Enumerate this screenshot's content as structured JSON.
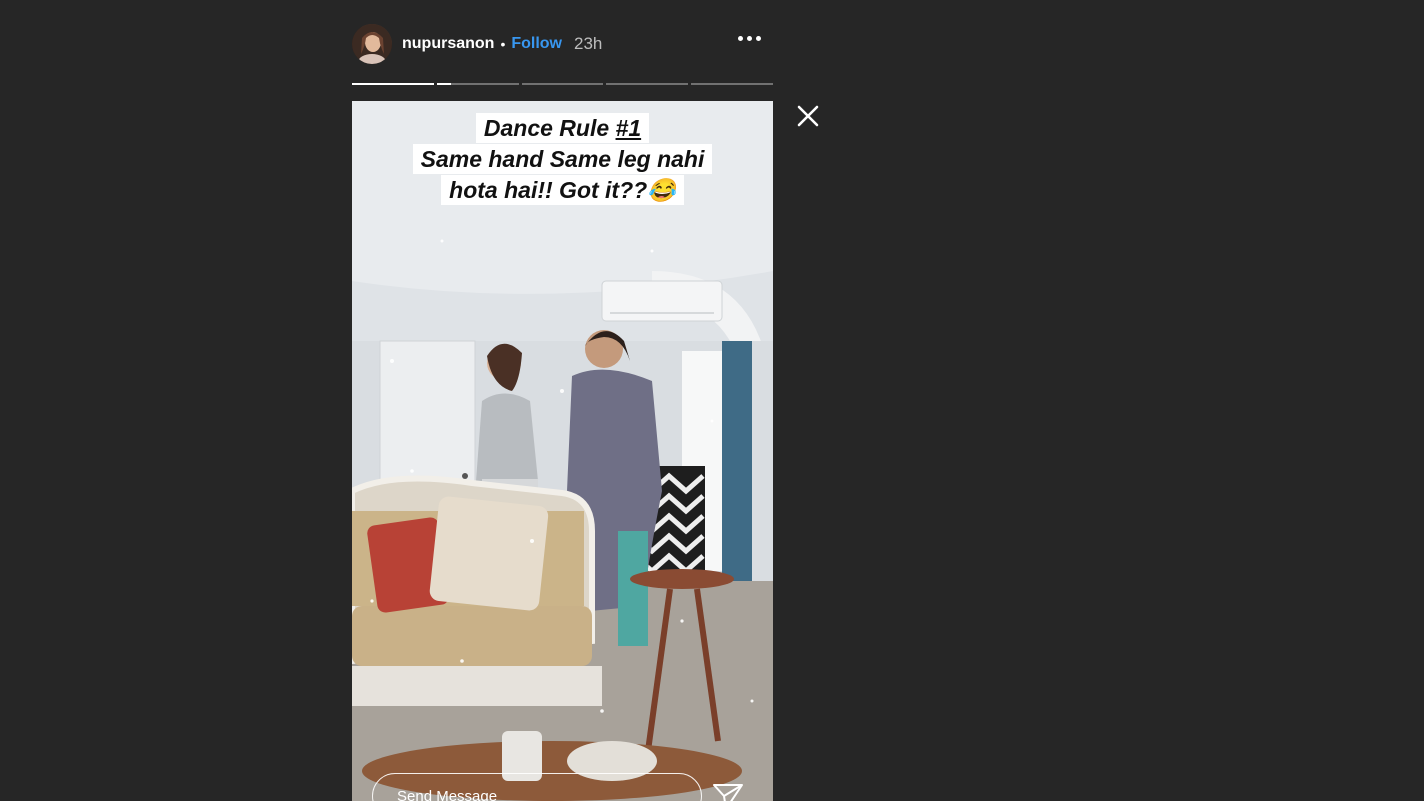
{
  "header": {
    "username": "nupursanon",
    "separator": "•",
    "follow_label": "Follow",
    "time": "23h"
  },
  "progress": {
    "segments": 5,
    "current_index": 1,
    "current_fraction": 0.17
  },
  "story": {
    "caption_line1_prefix": "Dance Rule ",
    "caption_line1_tag": "#1",
    "caption_line2": "Same hand Same leg nahi",
    "caption_line3": "hota hai!! Got it??😂"
  },
  "reply": {
    "placeholder": "Send Message"
  },
  "icons": {
    "more": "more-horizontal-icon",
    "close": "close-icon",
    "send": "send-icon"
  },
  "colors": {
    "background": "#262626",
    "follow": "#3897f0",
    "time": "#bdbdbd"
  }
}
